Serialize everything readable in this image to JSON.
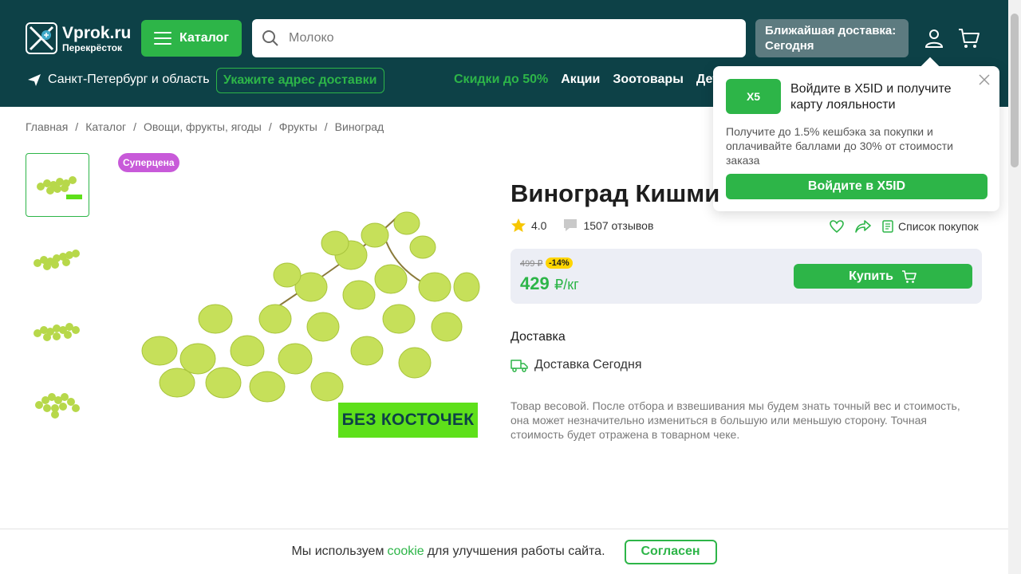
{
  "header": {
    "logo_main": "Vprok.ru",
    "logo_sub": "Перекрёсток",
    "catalog_label": "Каталог",
    "search_placeholder": "Молоко",
    "delivery_pill_line1": "Ближайшая доставка:",
    "delivery_pill_line2": "Сегодня",
    "region": "Санкт-Петербург и область",
    "address_button": "Укажите адрес доставки",
    "nav": [
      {
        "label": "Скидки до 50%"
      },
      {
        "label": "Акции"
      },
      {
        "label": "Зоотовары"
      },
      {
        "label": "Детс"
      }
    ]
  },
  "popup": {
    "logo_text": "X5",
    "title": "Войдите в X5ID и получите карту лояльности",
    "text": "Получите до 1.5% кешбэка за покупки и оплачивайте баллами до 30% от стоимости заказа",
    "button": "Войдите в X5ID"
  },
  "breadcrumbs": [
    "Главная",
    "Каталог",
    "Овощи, фрукты, ягоды",
    "Фрукты",
    "Виноград"
  ],
  "product": {
    "badge": "Суперцена",
    "image_label": "БЕЗ КОСТОЧЕК",
    "title": "Виноград Кишми",
    "rating": "4.0",
    "reviews": "1507 отзывов",
    "shopping_list": "Список покупок",
    "old_price": "499 ₽",
    "discount": "-14%",
    "price": "429",
    "price_unit": "₽/кг",
    "buy_label": "Купить",
    "delivery_heading": "Доставка",
    "delivery_text": "Доставка Сегодня",
    "weight_note": "Товар весовой. После отбора и взвешивания мы будем знать точный вес и стоимость, она может незначительно измениться в большую или меньшую сторону. Точная стоимость будет отражена в товарном чеке."
  },
  "cookie": {
    "text_before": "Мы используем",
    "link": "cookie",
    "text_after": "для улучшения работы сайта.",
    "button": "Согласен"
  },
  "colors": {
    "header_bg": "#0d4147",
    "accent_green": "#2db548",
    "badge_purple": "#c85ad9",
    "discount_yellow": "#ffd500"
  }
}
